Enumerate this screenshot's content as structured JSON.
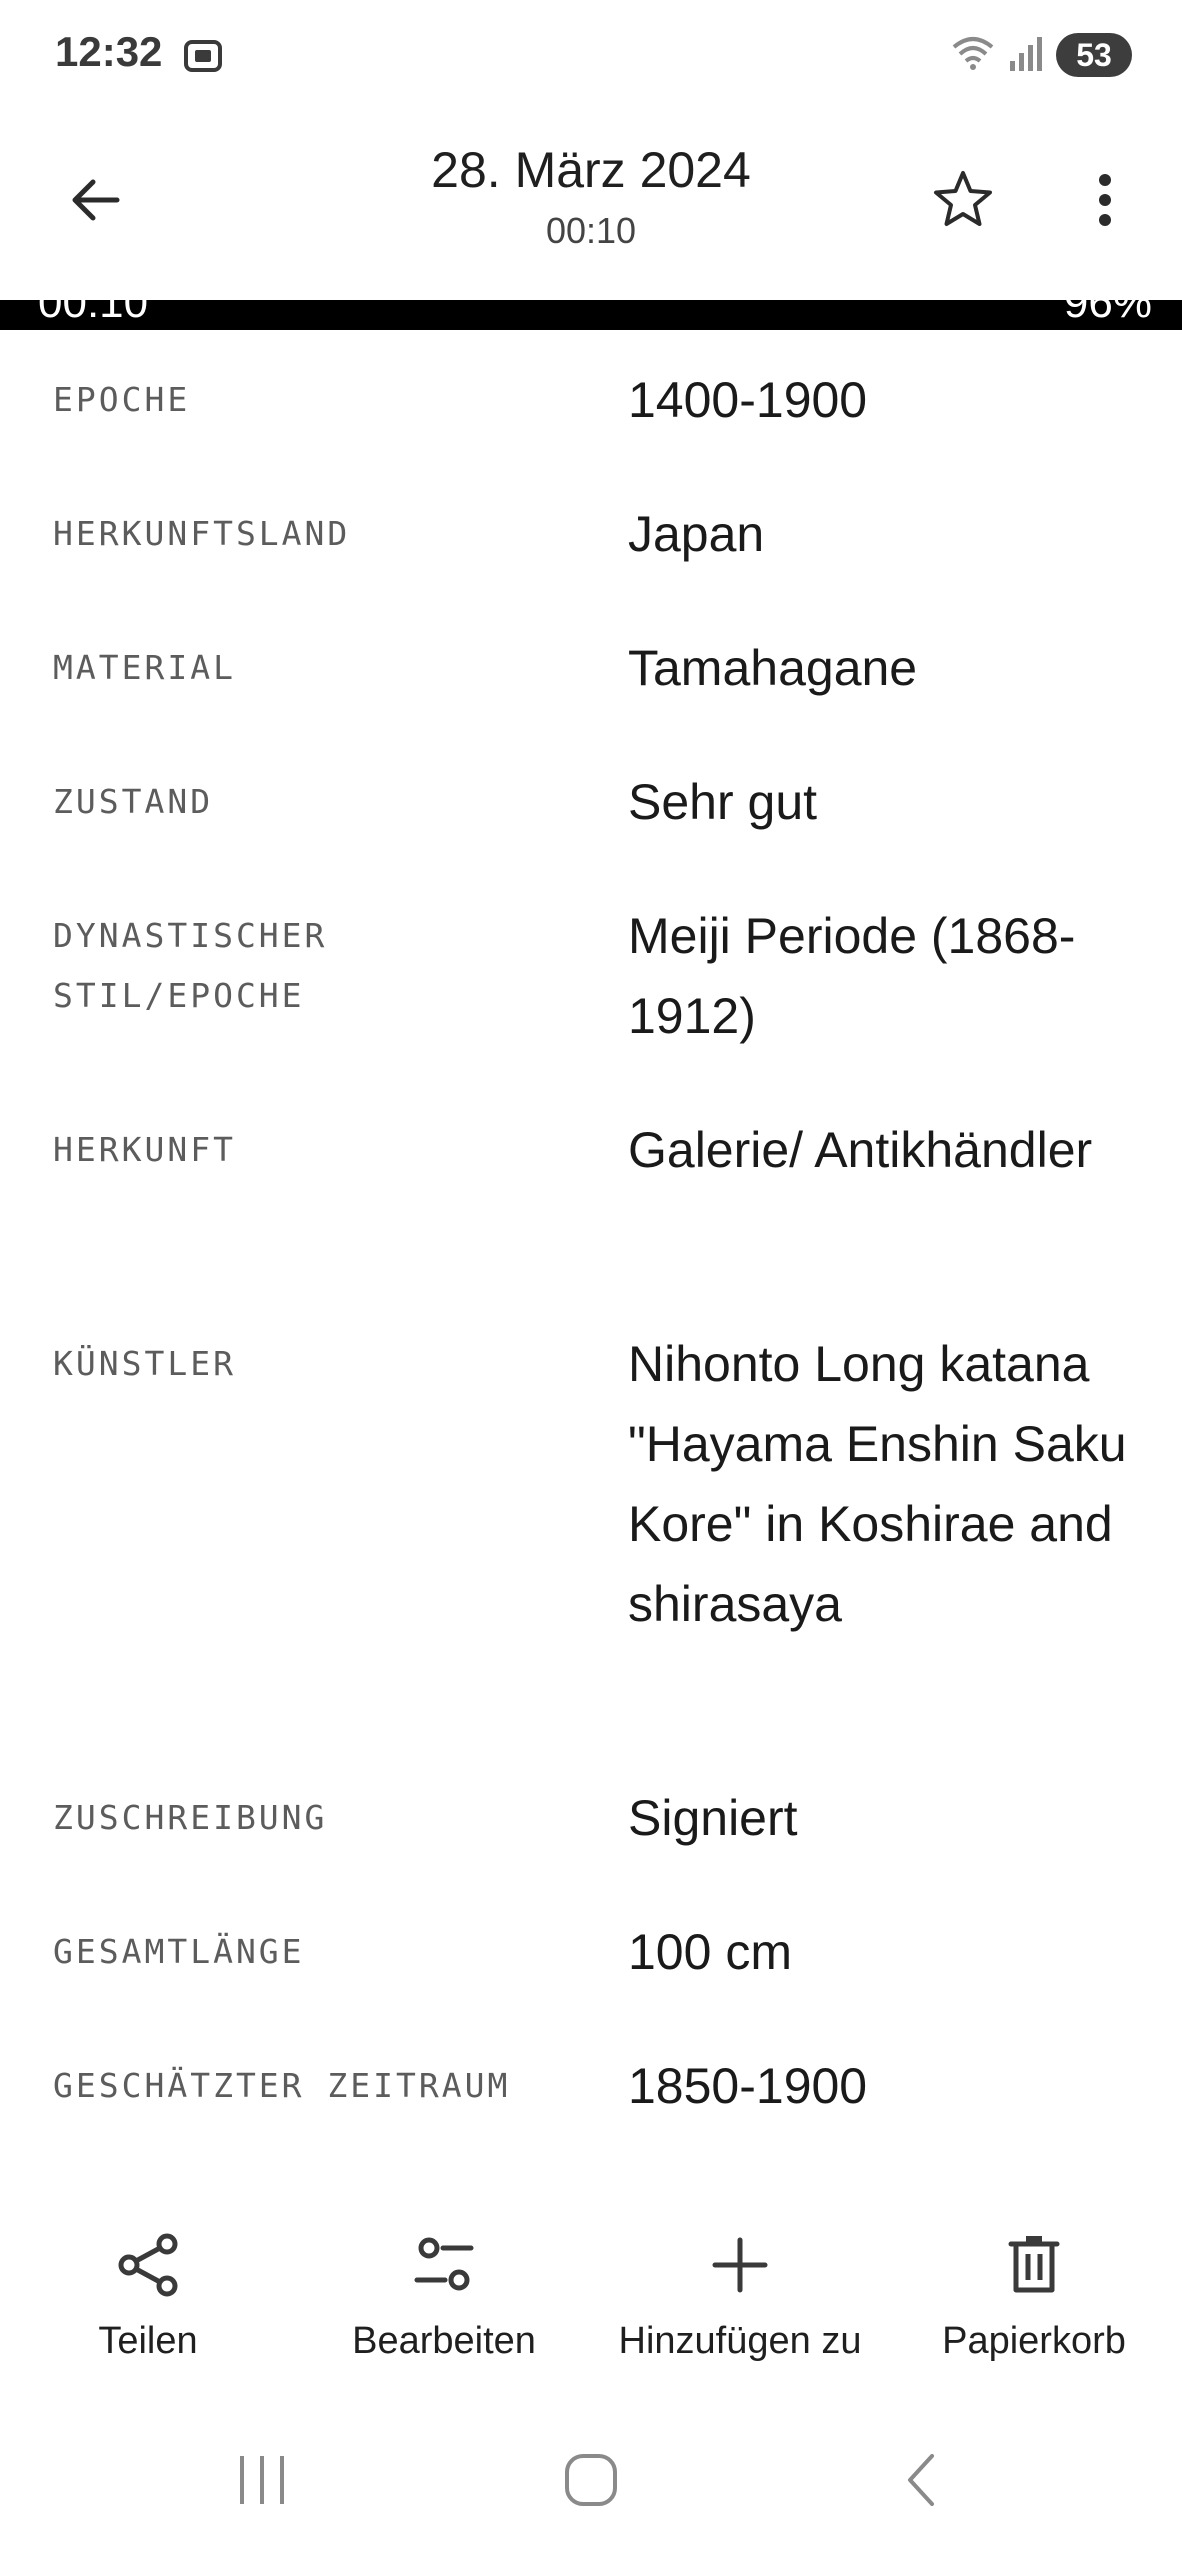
{
  "status_bar": {
    "time": "12:32",
    "battery": "53",
    "icons": [
      "screenshot-icon",
      "wifi-icon",
      "signal-icon"
    ]
  },
  "header": {
    "title": "28. März 2024",
    "subtitle": "00:10",
    "icons": [
      "back-arrow-icon",
      "star-icon",
      "more-vert-icon"
    ]
  },
  "embedded_strip": {
    "time": "00:10",
    "battery": "96%"
  },
  "details": [
    {
      "label": "EPOCHE",
      "value": "1400-1900"
    },
    {
      "label": "HERKUNFTSLAND",
      "value": "Japan"
    },
    {
      "label": "MATERIAL",
      "value": "Tamahagane"
    },
    {
      "label": "ZUSTAND",
      "value": "Sehr gut"
    },
    {
      "label": "DYNASTISCHER STIL/EPOCHE",
      "value": "Meiji Periode (1868-1912)"
    },
    {
      "label": "HERKUNFT",
      "value": "Galerie/ Antikhändler"
    },
    {
      "label": "KÜNSTLER",
      "value": "Nihonto Long katana \"Hayama Enshin Saku Kore\" in Koshirae and shirasaya"
    },
    {
      "label": "ZUSCHREIBUNG",
      "value": "Signiert"
    },
    {
      "label": "GESAMTLÄNGE",
      "value": "100 cm"
    },
    {
      "label": "GESCHÄTZTER ZEITRAUM",
      "value": "1850-1900"
    }
  ],
  "actions": [
    {
      "label": "Teilen",
      "icon": "share-icon"
    },
    {
      "label": "Bearbeiten",
      "icon": "edit-sliders-icon"
    },
    {
      "label": "Hinzufügen zu",
      "icon": "plus-icon"
    },
    {
      "label": "Papierkorb",
      "icon": "trash-icon"
    }
  ],
  "nav": [
    "recents-icon",
    "home-icon",
    "back-icon"
  ]
}
